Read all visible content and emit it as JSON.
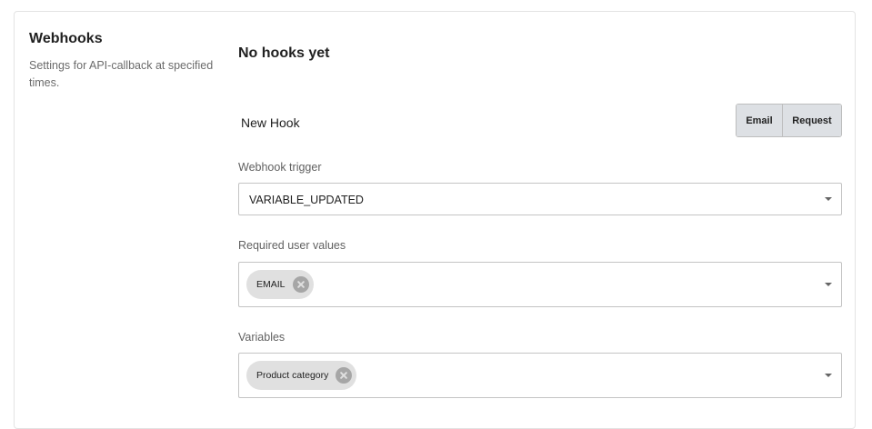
{
  "section": {
    "title": "Webhooks",
    "description": "Settings for API-callback at specified times."
  },
  "hooks": {
    "empty_title": "No hooks yet"
  },
  "new_hook": {
    "title": "New Hook",
    "type_buttons": {
      "email_label": "Email",
      "request_label": "Request"
    }
  },
  "fields": {
    "trigger": {
      "label": "Webhook trigger",
      "value": "VARIABLE_UPDATED"
    },
    "required_user_values": {
      "label": "Required user values",
      "chips": [
        "EMAIL"
      ]
    },
    "variables": {
      "label": "Variables",
      "chips": [
        "Product category"
      ]
    }
  },
  "icons": {
    "chip_remove": "close-circle-icon",
    "select_caret": "chevron-down-icon"
  }
}
